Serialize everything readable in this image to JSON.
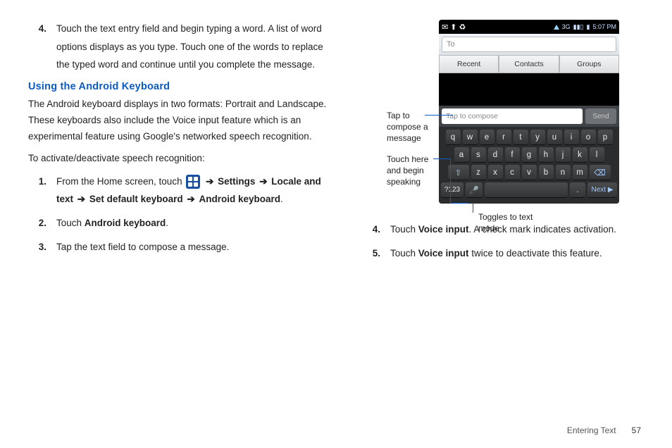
{
  "left": {
    "step4_num": "4.",
    "step4_text": "Touch the text entry field and begin typing a word. A list of word options displays as you type. Touch one of the words to replace the typed word and continue until you complete the message.",
    "heading": "Using the Android Keyboard",
    "para1": "The Android keyboard displays in two formats: Portrait and Landscape. These keyboards also include the Voice input feature which is an experimental feature using Google's networked speech recognition.",
    "para2": "To activate/deactivate speech recognition:",
    "l1_num": "1.",
    "l1_a": "From the Home screen, touch ",
    "l1_b": " Settings ",
    "l1_c": " Locale and text ",
    "l1_d": " Set default keyboard ",
    "l1_e": " Android keyboard",
    "l1_period": ".",
    "arrow": "➔",
    "l2_num": "2.",
    "l2_a": "Touch ",
    "l2_b": "Android keyboard",
    "l2_c": ".",
    "l3_num": "3.",
    "l3_text": "Tap the text field to compose a message."
  },
  "phone": {
    "status_time": "5:07 PM",
    "status_icons": "3G",
    "to_placeholder": "To",
    "tab1": "Recent",
    "tab2": "Contacts",
    "tab3": "Groups",
    "compose_placeholder": "Tap to compose",
    "send": "Send",
    "row1": [
      "q",
      "w",
      "e",
      "r",
      "t",
      "y",
      "u",
      "i",
      "o",
      "p"
    ],
    "row2": [
      "a",
      "s",
      "d",
      "f",
      "g",
      "h",
      "j",
      "k",
      "l"
    ],
    "row3_shift": "⇧",
    "row3": [
      "z",
      "x",
      "c",
      "v",
      "b",
      "n",
      "m"
    ],
    "row3_del": "⌫",
    "fn": "?123",
    "mic": "🎤",
    "dot": ".",
    "next": "Next ▶"
  },
  "callouts": {
    "c1": "Tap to compose a message",
    "c2": "Touch here and begin speaking",
    "c3": "Toggles to text mode"
  },
  "right": {
    "r4_num": "4.",
    "r4_a": "Touch ",
    "r4_b": "Voice input",
    "r4_c": ". A check mark indicates activation.",
    "r5_num": "5.",
    "r5_a": "Touch ",
    "r5_b": "Voice input",
    "r5_c": " twice to deactivate this feature."
  },
  "footer": {
    "section": "Entering Text",
    "page": "57"
  }
}
